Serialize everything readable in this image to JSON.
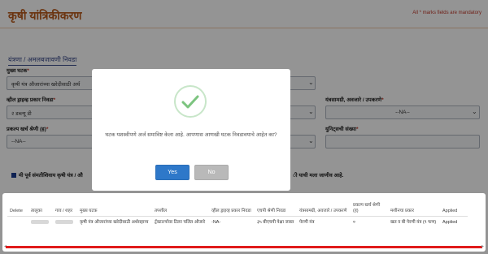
{
  "header": {
    "title": "कृषी यांत्रिकीकरण",
    "mandatory_note": "All * marks fields are mandatory"
  },
  "form": {
    "section_tag": "यंत्रणा / अमलबजावणी निवडा",
    "main_component": {
      "label": "मुख्य घटक",
      "value": "कृषी यंत्र औजारांच्या खरेदीसाठी अर्थ"
    },
    "hp_type": {
      "label": "व्हील ड्राइव्ह प्रकार निवडा",
      "value": "२ डब्ल्यू डी"
    },
    "machinery": {
      "label": "यंत्रसामग्री, अवजारे / उपकरणे",
      "value": "--NA--"
    },
    "expense_class": {
      "label": "प्रकल्प खर्च श्रेणी (ह)",
      "value": "--NA--"
    },
    "unit_count": {
      "label": "युनिट्सची संख्या"
    },
    "declaration_left": "मी पूर्व संमतीशिवाय कृषी यंत्र / औ",
    "declaration_right": "ी याची मला जाणीव आहे."
  },
  "modal": {
    "message": "घटक यशस्वीपणे अर्ज समाविष्ट केला आहे. आपणास आणखी घटक निवडावयाचे आहेत का?",
    "yes_label": "Yes",
    "no_label": "No"
  },
  "table": {
    "headers": [
      "Delete",
      "तालुका",
      "गाव / शहर",
      "मुख्य घटक",
      "तपशील",
      "व्हील ड्राइव्ह प्रकार निवडा",
      "एचपी श्रेणी निवडा",
      "यंत्रसामग्री, अवजारे / उपकरणे",
      "प्रकल्प खर्च श्रेणी (ह)",
      "मशीनचा प्रकार",
      "Applied"
    ],
    "rows": [
      {
        "main_component": "कृषी यंत्र औजारांच्या खरेदीसाठी अर्थसहाय्य",
        "details": "ट्रॅक्टर/पॉवर टिलर चलित औजारे",
        "wheel_drive": "-NA-",
        "hp_range": "३५ बीएचपी पेक्षा जास्त",
        "machinery": "पेरणी यंत्र",
        "expense": "०",
        "machine_type": "खत व बी पेरणी यंत्र (९ फण)",
        "status": "Applied"
      }
    ]
  },
  "colors": {
    "accent_title": "#b85a1c",
    "yes_button": "#2e78c9",
    "no_button": "#b9b9b9",
    "check_green": "#7cc47f",
    "scroll_red": "#e01b1b"
  }
}
